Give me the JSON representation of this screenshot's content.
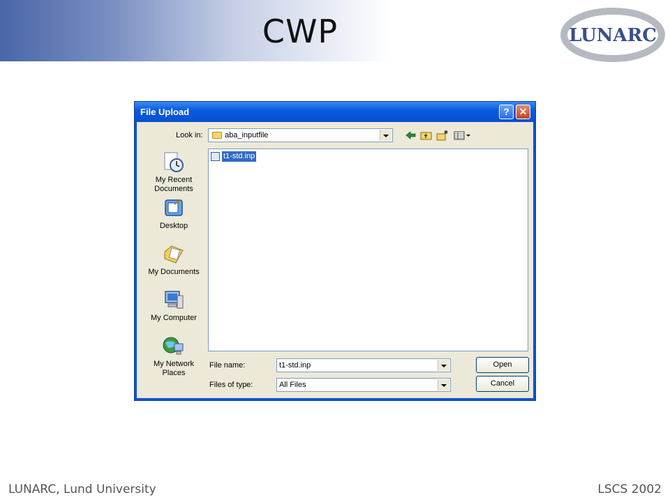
{
  "slide": {
    "title": "CWP",
    "logo_text": "LUNARC",
    "footer_left": "LUNARC, Lund University",
    "footer_right": "LSCS 2002"
  },
  "dialog": {
    "title": "File Upload",
    "help_glyph": "?",
    "close_glyph": "✕",
    "look_in_label": "Look in:",
    "look_in_value": "aba_inputfile",
    "places": [
      {
        "label_line1": "My Recent",
        "label_line2": "Documents",
        "icon": "recent-documents-icon"
      },
      {
        "label_line1": "Desktop",
        "label_line2": "",
        "icon": "desktop-icon"
      },
      {
        "label_line1": "My Documents",
        "label_line2": "",
        "icon": "my-documents-icon"
      },
      {
        "label_line1": "My Computer",
        "label_line2": "",
        "icon": "my-computer-icon"
      },
      {
        "label_line1": "My Network",
        "label_line2": "Places",
        "icon": "network-places-icon"
      }
    ],
    "files": [
      {
        "name": "t1-std.inp",
        "selected": true
      }
    ],
    "file_name_label": "File name:",
    "file_name_value": "t1-std.inp",
    "files_of_type_label": "Files of type:",
    "files_of_type_value": "All Files",
    "open_label": "Open",
    "cancel_label": "Cancel"
  },
  "colors": {
    "titlebar": "#0a5be0",
    "dialog_body": "#ece9d8",
    "selection": "#316ac5",
    "header_gradient": "#4a66a8"
  }
}
